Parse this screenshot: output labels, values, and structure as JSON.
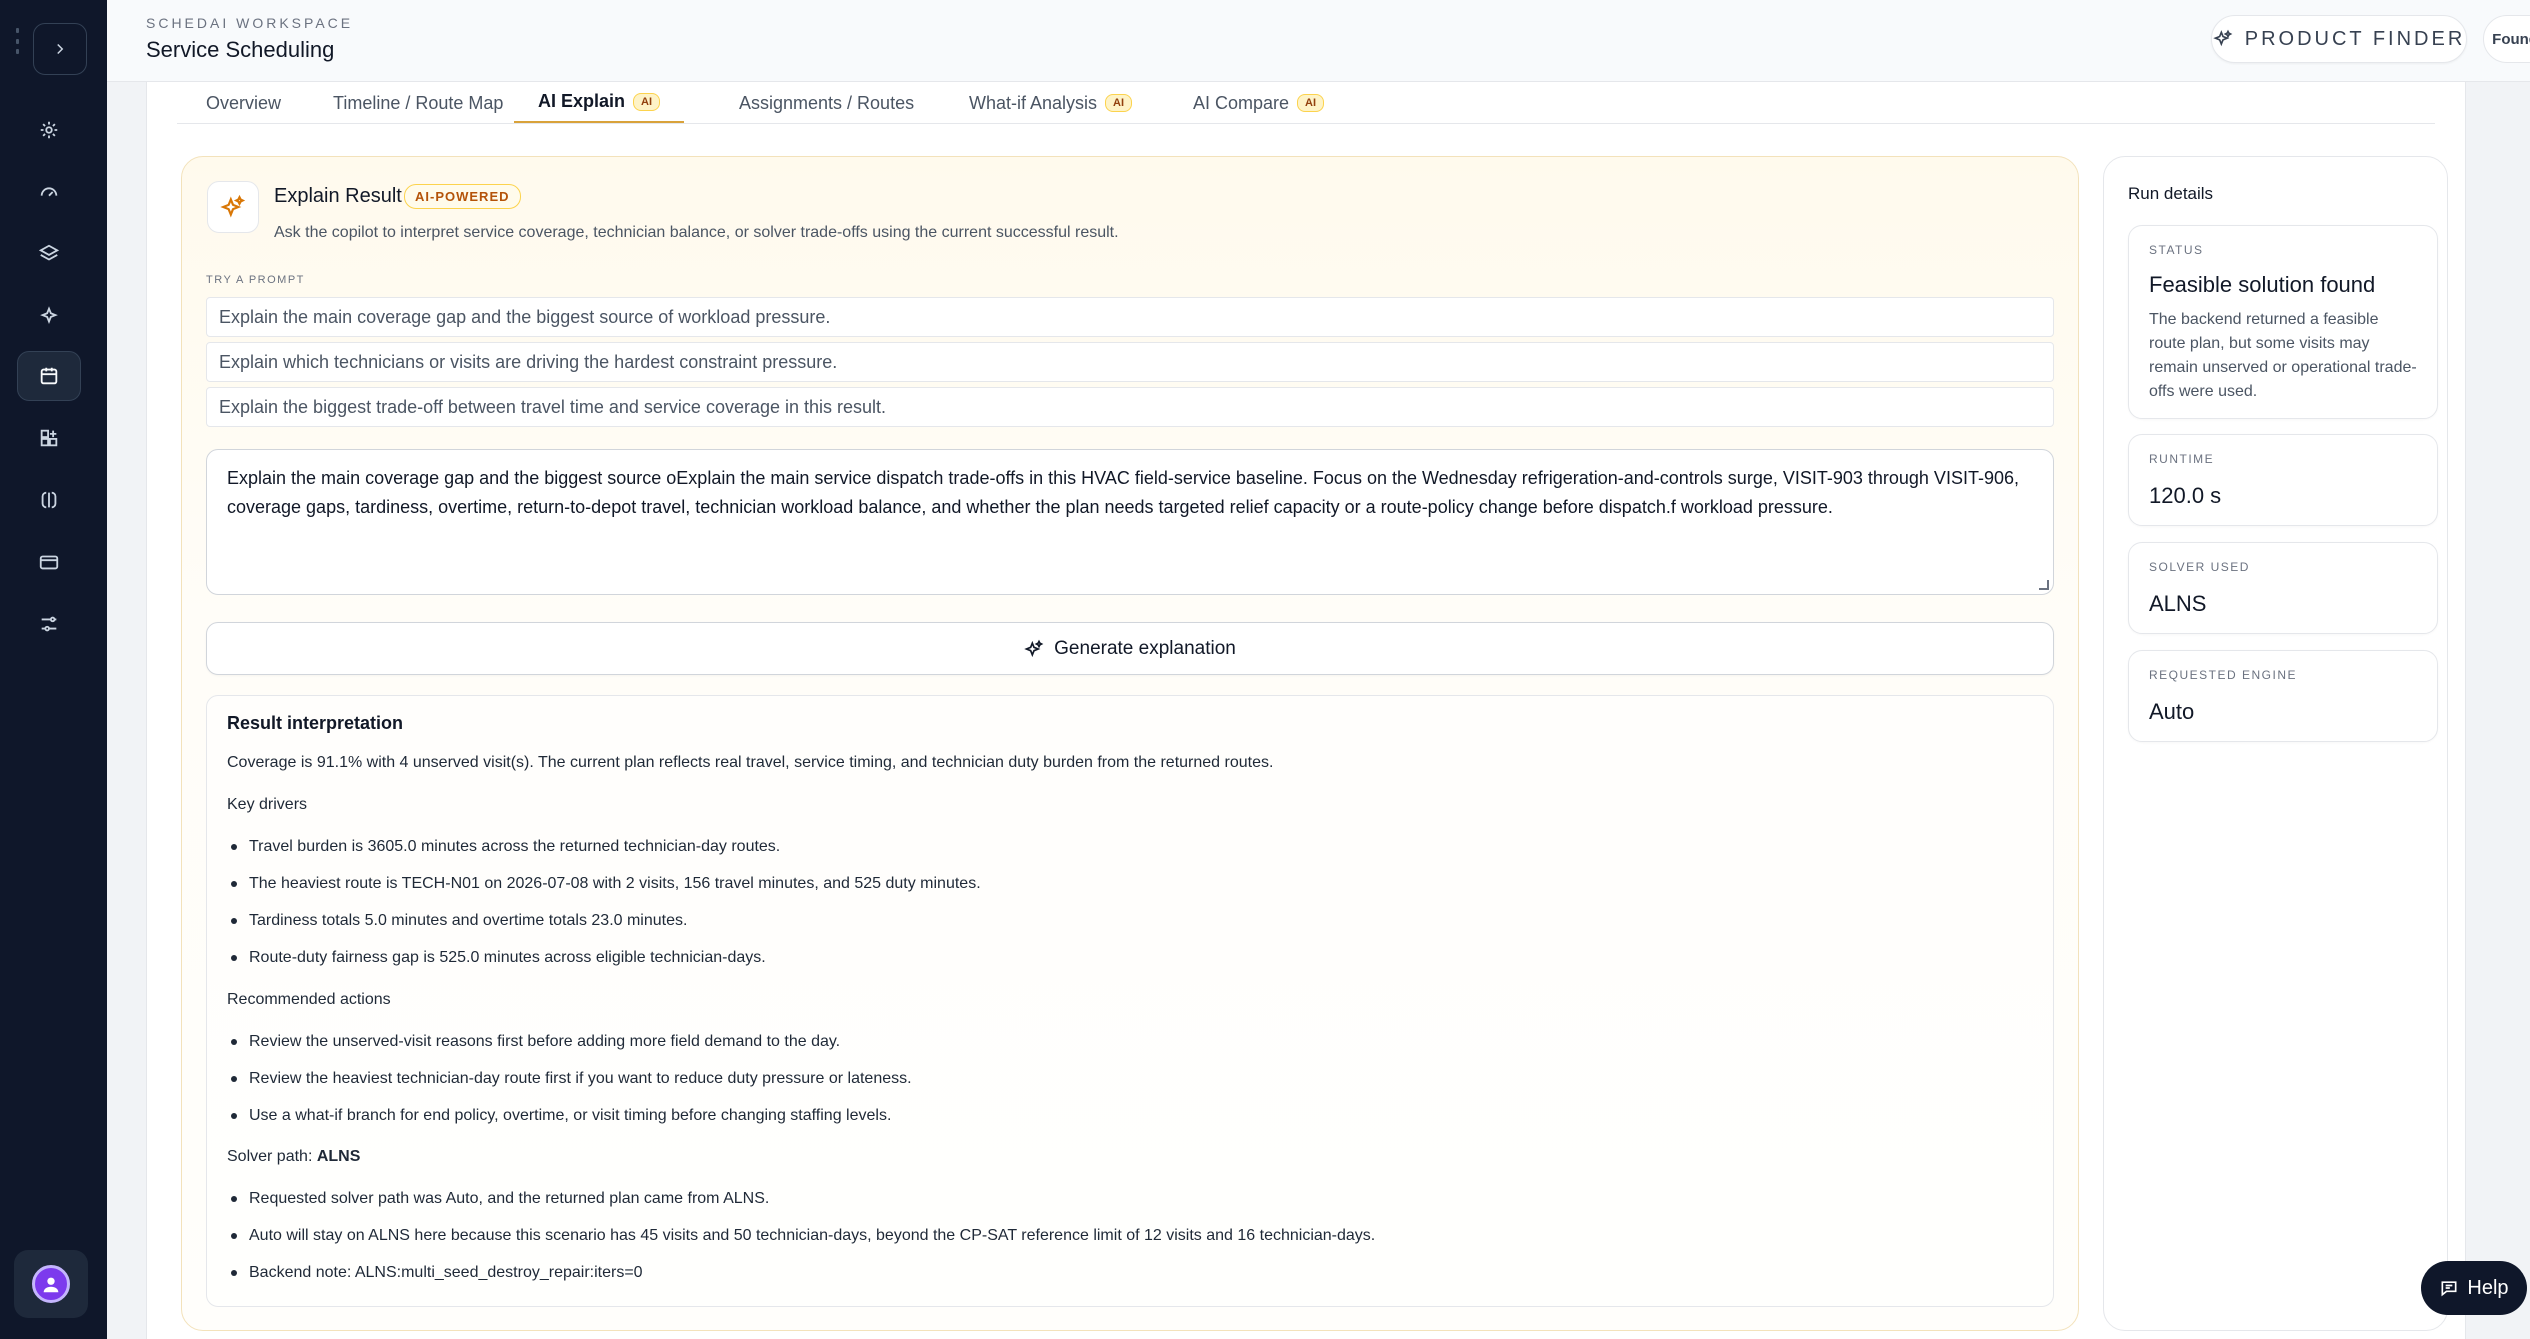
{
  "sidebar": {
    "toggle_icon": "chevron-right-icon",
    "items": [
      {
        "icon": "settings-icon"
      },
      {
        "icon": "gauge-icon"
      },
      {
        "icon": "layers-icon"
      },
      {
        "icon": "sparkles-icon"
      },
      {
        "icon": "calendar-icon",
        "active": true
      },
      {
        "icon": "grid-plus-icon"
      },
      {
        "icon": "brain-icon"
      },
      {
        "icon": "credit-card-icon"
      },
      {
        "icon": "sliders-icon"
      }
    ],
    "avatar_icon": "user-icon"
  },
  "header": {
    "workspace_label": "SCHEDAI WORKSPACE",
    "title": "Service Scheduling",
    "product_finder_label": "PRODUCT FINDER",
    "account_label": "Founder account"
  },
  "tabs": [
    {
      "label": "Overview"
    },
    {
      "label": "Timeline / Route Map"
    },
    {
      "label": "AI Explain",
      "badge": "AI",
      "active": true
    },
    {
      "label": "Assignments / Routes"
    },
    {
      "label": "What-if Analysis",
      "badge": "AI"
    },
    {
      "label": "AI Compare",
      "badge": "AI"
    }
  ],
  "explain": {
    "title": "Explain Result",
    "badge": "AI-POWERED",
    "subtitle": "Ask the copilot to interpret service coverage, technician balance, or solver trade-offs using the current successful result.",
    "try_label": "TRY A PROMPT",
    "prompts": [
      "Explain the main coverage gap and the biggest source of workload pressure.",
      "Explain which technicians or visits are driving the hardest constraint pressure.",
      "Explain the biggest trade-off between travel time and service coverage in this result."
    ],
    "textarea_value": "Explain the main coverage gap and the biggest source oExplain the main service dispatch trade-offs in this HVAC field-service baseline. Focus on the Wednesday refrigeration-and-controls surge, VISIT-903 through VISIT-906, coverage gaps, tardiness, overtime, return-to-depot travel, technician workload balance, and whether the plan needs targeted relief capacity or a route-policy change before dispatch.f workload pressure.",
    "generate_label": "Generate explanation"
  },
  "result": {
    "title": "Result interpretation",
    "summary": "Coverage is 91.1% with 4 unserved visit(s). The current plan reflects real travel, service timing, and technician duty burden from the returned routes.",
    "drivers_heading": "Key drivers",
    "drivers": [
      "Travel burden is 3605.0 minutes across the returned technician-day routes.",
      "The heaviest route is TECH-N01 on 2026-07-08 with 2 visits, 156 travel minutes, and 525 duty minutes.",
      "Tardiness totals 5.0 minutes and overtime totals 23.0 minutes.",
      "Route-duty fairness gap is 525.0 minutes across eligible technician-days."
    ],
    "actions_heading": "Recommended actions",
    "actions": [
      "Review the unserved-visit reasons first before adding more field demand to the day.",
      "Review the heaviest technician-day route first if you want to reduce duty pressure or lateness.",
      "Use a what-if branch for end policy, overtime, or visit timing before changing staffing levels."
    ],
    "solver_path_label": "Solver path:",
    "solver_path_value": "ALNS",
    "solver_notes": [
      "Requested solver path was Auto, and the returned plan came from ALNS.",
      "Auto will stay on ALNS here because this scenario has 45 visits and 50 technician-days, beyond the CP-SAT reference limit of 12 visits and 16 technician-days.",
      "Backend note: ALNS:multi_seed_destroy_repair:iters=0"
    ]
  },
  "run_details": {
    "title": "Run details",
    "status_label": "STATUS",
    "status_value": "Feasible solution found",
    "status_desc": "The backend returned a feasible route plan, but some visits may remain unserved or operational trade-offs were used.",
    "runtime_label": "RUNTIME",
    "runtime_value": "120.0 s",
    "solver_label": "SOLVER USED",
    "solver_value": "ALNS",
    "engine_label": "REQUESTED ENGINE",
    "engine_value": "Auto"
  },
  "help_label": "Help",
  "colors": {
    "sidebar_bg": "#0f172a",
    "accent": "#d9a23a",
    "help_bg": "#0f172a"
  }
}
